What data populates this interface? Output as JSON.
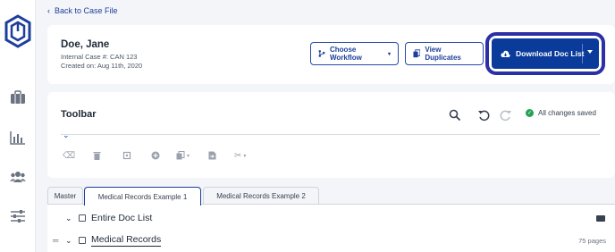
{
  "nav": {
    "back_label": "Back to Case File"
  },
  "sidebar": {
    "items": [
      "briefcase-icon",
      "chart-icon",
      "users-icon",
      "sliders-icon"
    ]
  },
  "header": {
    "name": "Doe, Jane",
    "internal_case": "Internal Case #: CAN 123",
    "created_on": "Created on: Aug 11th, 2020",
    "choose_workflow_label": "Choose Workflow",
    "view_duplicates_label": "View Duplicates",
    "download_label": "Download Doc List"
  },
  "toolbar": {
    "title": "Toolbar",
    "saved_status": "All changes saved"
  },
  "tabs": [
    {
      "label": "Master"
    },
    {
      "label": "Medical Records Example 1"
    },
    {
      "label": "Medical Records Example 2"
    }
  ],
  "doc_list": {
    "root_label": "Entire Doc List",
    "rows": [
      {
        "label": "Medical Records",
        "pages": "75 pages"
      }
    ]
  },
  "colors": {
    "accent": "#0b3b9a",
    "highlight_ring": "#2c2fa6",
    "success": "#23a455"
  }
}
